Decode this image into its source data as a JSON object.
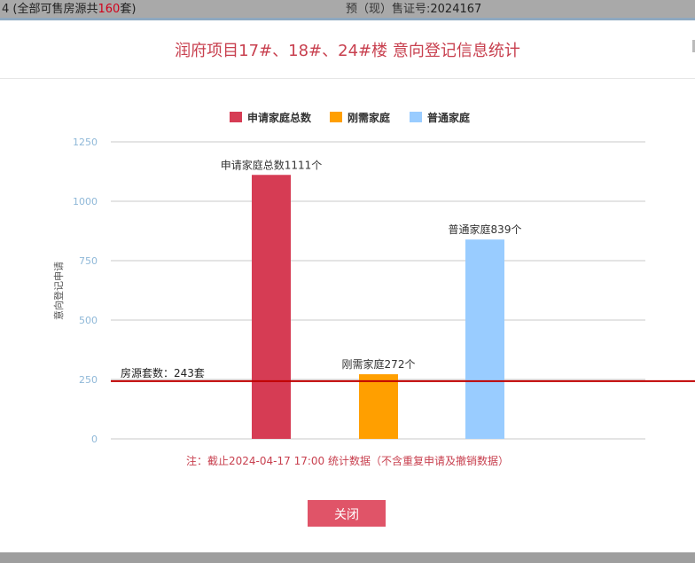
{
  "topbar": {
    "left_prefix": "4 (全部可售房源共",
    "left_count": "160",
    "left_suffix": "套)",
    "right_label": "预（现）售证号:",
    "right_value": "2024167"
  },
  "modal": {
    "title": "润府项目17#、18#、24#楼 意向登记信息统计",
    "note": "注：截止2024-04-17 17:00 统计数据（不含重复申请及撤销数据）",
    "close_label": "关闭"
  },
  "colors": {
    "series": [
      "#d63c54",
      "#ff9f00",
      "#99ccff"
    ],
    "refline": "#c00000",
    "accent": "#c8404f",
    "button": "#e05468"
  },
  "chart_data": {
    "type": "bar",
    "ylabel": "意向登记申请",
    "ylim": [
      0,
      1250
    ],
    "yticks": [
      0,
      250,
      500,
      750,
      1000,
      1250
    ],
    "grid": true,
    "legend_position": "top",
    "series": [
      {
        "name": "申请家庭总数",
        "value": 1111,
        "label": "申请家庭总数1111个"
      },
      {
        "name": "刚需家庭",
        "value": 272,
        "label": "刚需家庭272个"
      },
      {
        "name": "普通家庭",
        "value": 839,
        "label": "普通家庭839个"
      }
    ],
    "reference_line": {
      "value": 243,
      "label": "房源套数：243套"
    }
  }
}
